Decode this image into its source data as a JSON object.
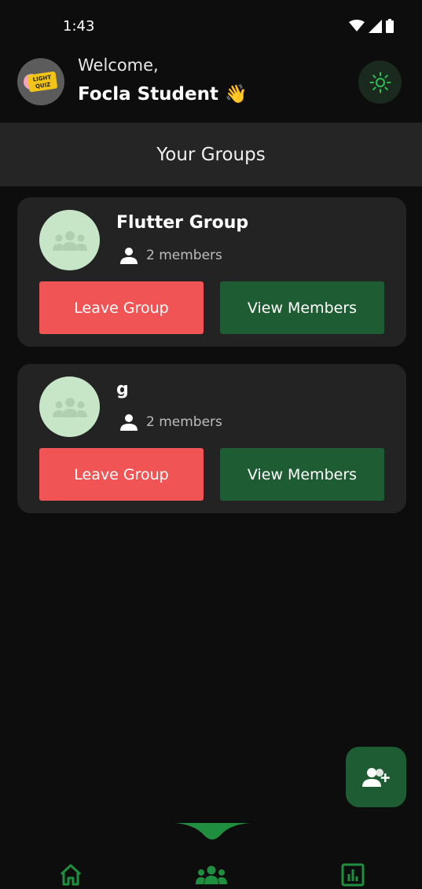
{
  "status_bar": {
    "time": "1:43",
    "icons": [
      "wifi-icon",
      "signal-icon",
      "battery-icon"
    ]
  },
  "header": {
    "avatar_logo_text": "LIGHT QUIZ",
    "welcome": "Welcome,",
    "username": "Focla Student 👋",
    "theme_toggle_icon": "sun-icon"
  },
  "page_title": "Your Groups",
  "groups": [
    {
      "name": "Flutter Group",
      "members": "2 members",
      "leave_label": "Leave Group",
      "view_label": "View Members"
    },
    {
      "name": "g",
      "members": "2 members",
      "leave_label": "Leave Group",
      "view_label": "View Members"
    }
  ],
  "fab": {
    "icon": "add-person-icon"
  },
  "bottom_nav": {
    "items": [
      {
        "icon": "home-icon",
        "active": false
      },
      {
        "icon": "groups-icon",
        "active": true
      },
      {
        "icon": "stats-icon",
        "active": false
      }
    ]
  },
  "colors": {
    "background": "#0d0d0d",
    "card": "#232323",
    "leave_button": "#f05454",
    "view_button": "#1e5c34",
    "accent_green": "#1f8f3f",
    "group_avatar_bg": "#c6e6c7"
  }
}
